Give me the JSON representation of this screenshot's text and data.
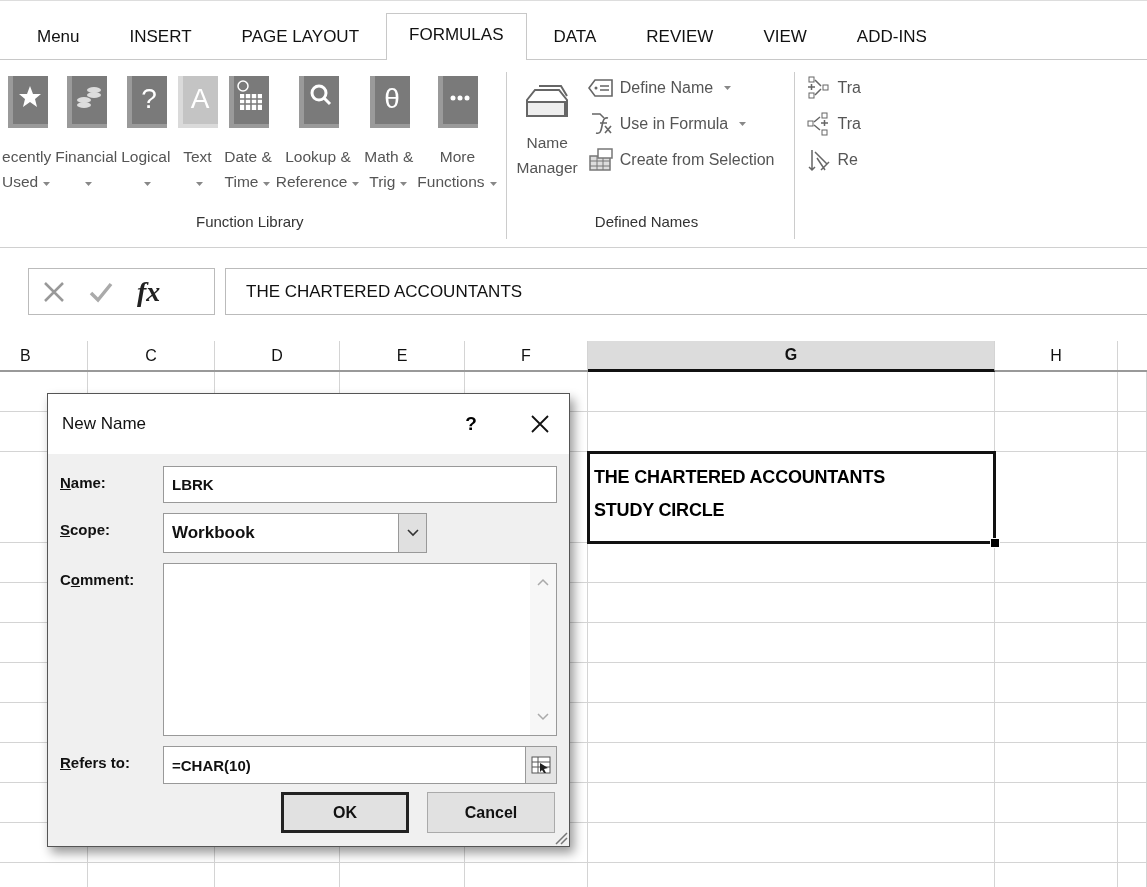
{
  "ribbon_tabs": [
    {
      "label": "Menu",
      "selected": false
    },
    {
      "label": "INSERT",
      "selected": false
    },
    {
      "label": "PAGE LAYOUT",
      "selected": false
    },
    {
      "label": "FORMULAS",
      "selected": true
    },
    {
      "label": "DATA",
      "selected": false
    },
    {
      "label": "REVIEW",
      "selected": false
    },
    {
      "label": "VIEW",
      "selected": false
    },
    {
      "label": "ADD-INS",
      "selected": false
    }
  ],
  "function_library": {
    "group_label": "Function Library",
    "buttons": [
      {
        "line1": "ecently",
        "line2": "Used",
        "dropdown": true,
        "kind": "star",
        "dimmed": false
      },
      {
        "line1": "Financial",
        "dropdown": true,
        "kind": "coins",
        "dimmed": false
      },
      {
        "line1": "Logical",
        "dropdown": true,
        "kind": "glyph",
        "glyph": "?",
        "dimmed": false
      },
      {
        "line1": "Text",
        "dropdown": true,
        "kind": "glyph",
        "glyph": "A",
        "dimmed": true
      },
      {
        "line1": "Date &",
        "line2": "Time",
        "dropdown": true,
        "kind": "calendar",
        "dimmed": false
      },
      {
        "line1": "Lookup &",
        "line2": "Reference",
        "dropdown": true,
        "kind": "search",
        "dimmed": false
      },
      {
        "line1": "Math &",
        "line2": "Trig",
        "dropdown": true,
        "kind": "glyph",
        "glyph": "θ",
        "dimmed": false
      },
      {
        "line1": "More",
        "line2": "Functions",
        "dropdown": true,
        "kind": "dots",
        "dimmed": false
      }
    ]
  },
  "defined_names": {
    "group_label": "Defined Names",
    "name_manager": {
      "line1": "Name",
      "line2": "Manager"
    },
    "items": [
      {
        "label": "Define Name",
        "dropdown": true,
        "kind": "tag"
      },
      {
        "label": "Use in Formula",
        "dropdown": true,
        "kind": "formula"
      },
      {
        "label": "Create from Selection",
        "dropdown": false,
        "kind": "table"
      }
    ]
  },
  "formula_auditing": {
    "items": [
      {
        "label": "Tra",
        "kind": "precedents"
      },
      {
        "label": "Tra",
        "kind": "dependents"
      },
      {
        "label": "Re",
        "kind": "remove"
      }
    ]
  },
  "formula_bar": {
    "function_label": "fx",
    "value": "THE CHARTERED ACCOUNTANTS"
  },
  "columns": [
    {
      "label": "B",
      "selected": false
    },
    {
      "label": "C",
      "selected": false
    },
    {
      "label": "D",
      "selected": false
    },
    {
      "label": "E",
      "selected": false
    },
    {
      "label": "F",
      "selected": false
    },
    {
      "label": "G",
      "selected": true
    },
    {
      "label": "H",
      "selected": false
    }
  ],
  "cell": {
    "text": "THE CHARTERED ACCOUNTANTS\nSTUDY CIRCLE",
    "selected": true
  },
  "dialog": {
    "title": "New Name",
    "help": "?",
    "name": {
      "access_key": "N",
      "label_rest": "ame:",
      "value": "LBRK"
    },
    "scope": {
      "access_key": "S",
      "label_rest": "cope:",
      "value": "Workbook"
    },
    "comment": {
      "label_start": "C",
      "access_key": "o",
      "label_rest": "mment:"
    },
    "refers_to": {
      "access_key": "R",
      "label_rest": "efers to:",
      "value": "=CHAR(10)"
    },
    "buttons": [
      {
        "label": "OK",
        "default": true
      },
      {
        "label": "Cancel",
        "default": false
      }
    ]
  }
}
